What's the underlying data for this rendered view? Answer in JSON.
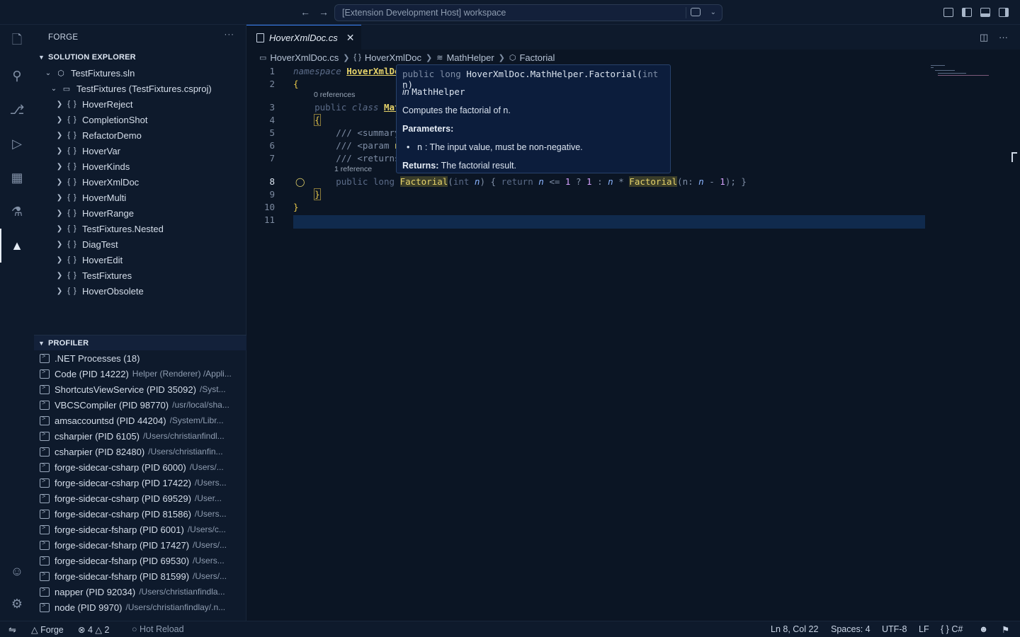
{
  "titlebar": {
    "search_text": "[Extension Development Host] workspace"
  },
  "sidebar": {
    "title": "FORGE",
    "solution_explorer": {
      "header": "SOLUTION EXPLORER",
      "solution": "TestFixtures.sln",
      "project": "TestFixtures (TestFixtures.csproj)",
      "namespaces": [
        "HoverReject",
        "CompletionShot",
        "RefactorDemo",
        "HoverVar",
        "HoverKinds",
        "HoverXmlDoc",
        "HoverMulti",
        "HoverRange",
        "TestFixtures.Nested",
        "DiagTest",
        "HoverEdit",
        "TestFixtures",
        "HoverObsolete"
      ]
    },
    "profiler": {
      "header": "PROFILER",
      "root": ".NET Processes (18)",
      "processes": [
        {
          "name": "Code (PID 14222)",
          "path": "Helper (Renderer) /Appli..."
        },
        {
          "name": "ShortcutsViewService (PID 35092)",
          "path": "/Syst..."
        },
        {
          "name": "VBCSCompiler (PID 98770)",
          "path": "/usr/local/sha..."
        },
        {
          "name": "amsaccountsd (PID 44204)",
          "path": "/System/Libr..."
        },
        {
          "name": "csharpier (PID 6105)",
          "path": "/Users/christianfindl..."
        },
        {
          "name": "csharpier (PID 82480)",
          "path": "/Users/christianfin..."
        },
        {
          "name": "forge-sidecar-csharp (PID 6000)",
          "path": "/Users/..."
        },
        {
          "name": "forge-sidecar-csharp (PID 17422)",
          "path": "/Users..."
        },
        {
          "name": "forge-sidecar-csharp (PID 69529)",
          "path": "/User..."
        },
        {
          "name": "forge-sidecar-csharp (PID 81586)",
          "path": "/Users..."
        },
        {
          "name": "forge-sidecar-fsharp (PID 6001)",
          "path": "/Users/c..."
        },
        {
          "name": "forge-sidecar-fsharp (PID 17427)",
          "path": "/Users/..."
        },
        {
          "name": "forge-sidecar-fsharp (PID 69530)",
          "path": "/Users..."
        },
        {
          "name": "forge-sidecar-fsharp (PID 81599)",
          "path": "/Users/..."
        },
        {
          "name": "napper (PID 92034)",
          "path": "/Users/christianfindla..."
        },
        {
          "name": "node (PID 9970)",
          "path": "/Users/christianfindlay/.n..."
        }
      ]
    }
  },
  "editor": {
    "tab_title": "HoverXmlDoc.cs",
    "breadcrumb": [
      "HoverXmlDoc.cs",
      "HoverXmlDoc",
      "MathHelper",
      "Factorial"
    ],
    "line_numbers": [
      "1",
      "2",
      "3",
      "4",
      "5",
      "6",
      "7",
      "8",
      "9",
      "10",
      "11"
    ],
    "codelens": {
      "line3": "0 references",
      "line8": "1 reference"
    },
    "code": {
      "l1_kw": "namespace",
      "l1_name": "HoverXmlDoc",
      "l3_kw1": "public",
      "l3_kw2": "class",
      "l3_name": "Mat",
      "l5": "/// <summary",
      "l6a": "/// <param ",
      "l6b": "n",
      "l7": "/// <returns",
      "l8_public": "public",
      "l8_long": "long",
      "l8_fn": "Factorial",
      "l8_open": "(",
      "l8_int": "int",
      "l8_n": "n",
      "l8_close": ")",
      "l8_brace": "{",
      "l8_return": "return",
      "l8_n2": "n",
      "l8_le": "<=",
      "l8_one": "1",
      "l8_q": "?",
      "l8_one2": "1",
      "l8_colon": ":",
      "l8_n3": "n",
      "l8_mul": "*",
      "l8_fn2": "Factorial",
      "l8_open2": "(",
      "l8_label": "n:",
      "l8_n4": "n",
      "l8_minus": "-",
      "l8_one3": "1",
      "l8_end": ");",
      "l8_brace2": "}"
    }
  },
  "hover": {
    "sig_kw1": "public",
    "sig_kw2": "long",
    "sig_name": "HoverXmlDoc.MathHelper.Factorial",
    "sig_open": "(",
    "sig_param_type": "int",
    "sig_param": "n",
    "sig_close": ")",
    "in_prefix": "in",
    "in_class": "MathHelper",
    "summary": "Computes the factorial of n.",
    "params_label": "Parameters:",
    "param_name": "n",
    "param_desc": ": The input value, must be non-negative.",
    "returns_label": "Returns:",
    "returns_text": "The factorial result."
  },
  "statusbar": {
    "branch": "Forge",
    "errors": "4",
    "warnings": "2",
    "hot_reload": "Hot Reload",
    "position": "Ln 8, Col 22",
    "spaces": "Spaces: 4",
    "encoding": "UTF-8",
    "eol": "LF",
    "language": "C#"
  }
}
